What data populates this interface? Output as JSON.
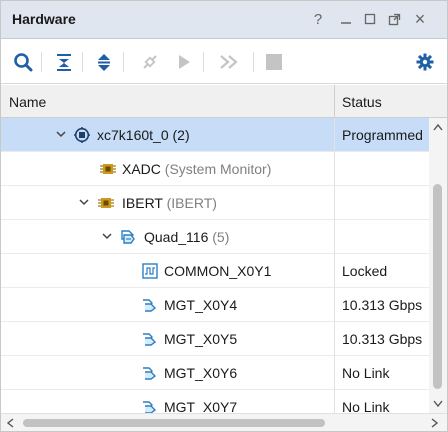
{
  "panel": {
    "title": "Hardware",
    "controls": {
      "help": "?",
      "minimize": "_",
      "maximize": "□",
      "float": "⧉",
      "close": "×"
    }
  },
  "toolbar": {
    "icons": [
      "search-icon",
      "collapse-all-icon",
      "expand-all-icon",
      "auto-connect-icon",
      "run-trigger-icon",
      "run-trigger-immediate-icon",
      "stop-trigger-icon",
      "settings-icon"
    ]
  },
  "columns": {
    "name": "Name",
    "status": "Status"
  },
  "rows": [
    {
      "name": "xc7k160t_0",
      "suffix": " (2)",
      "status": "Programmed",
      "icon": "fpga-chip-icon",
      "expanded": true,
      "selected": true
    },
    {
      "name": "XADC",
      "suffix": " (System Monitor)",
      "status": "",
      "icon": "xadc-icon",
      "expanded": null,
      "selected": false
    },
    {
      "name": "IBERT",
      "suffix": " (IBERT)",
      "status": "",
      "icon": "ibert-icon",
      "expanded": true,
      "selected": false
    },
    {
      "name": "Quad_116",
      "suffix": " (5)",
      "status": "",
      "icon": "quad-icon",
      "expanded": true,
      "selected": false
    },
    {
      "name": "COMMON_X0Y1",
      "suffix": "",
      "status": "Locked",
      "icon": "common-pll-icon",
      "expanded": null,
      "selected": false
    },
    {
      "name": "MGT_X0Y4",
      "suffix": "",
      "status": "10.313 Gbps",
      "icon": "mgt-icon",
      "expanded": null,
      "selected": false
    },
    {
      "name": "MGT_X0Y5",
      "suffix": "",
      "status": "10.313 Gbps",
      "icon": "mgt-icon",
      "expanded": null,
      "selected": false
    },
    {
      "name": "MGT_X0Y6",
      "suffix": "",
      "status": "No Link",
      "icon": "mgt-icon",
      "expanded": null,
      "selected": false
    },
    {
      "name": "MGT_X0Y7",
      "suffix": "",
      "status": "No Link",
      "icon": "mgt-icon",
      "expanded": null,
      "selected": false
    }
  ],
  "colors": {
    "selection": "#c6dcf7",
    "titlebar": "#dfe6ef",
    "icon_blue": "#1f5fa8",
    "chip_gold": "#c99a1c"
  }
}
